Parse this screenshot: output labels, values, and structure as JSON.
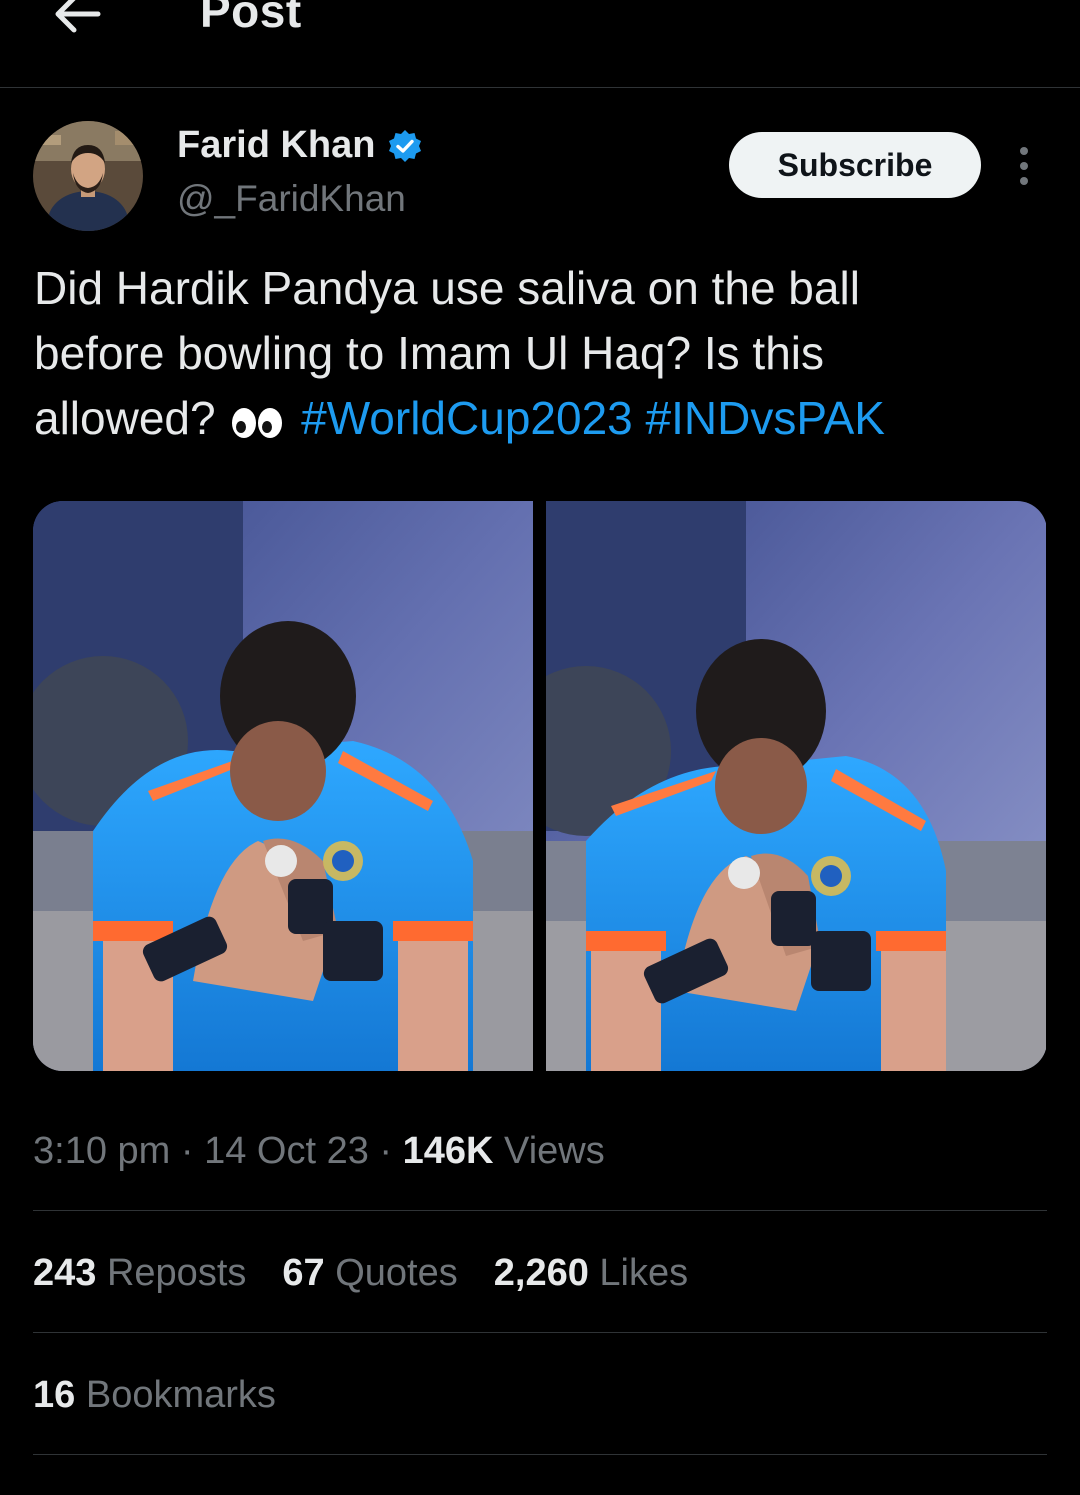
{
  "header": {
    "title": "Post",
    "back_icon": "arrow-left-icon"
  },
  "author": {
    "display_name": "Farid Khan",
    "handle": "@_FaridKhan",
    "verified_icon": "verified-badge-icon",
    "verified_color": "#1d9bf0"
  },
  "actions": {
    "subscribe_label": "Subscribe",
    "more_icon": "more-vertical-icon"
  },
  "tweet": {
    "text_line1": "Did Hardik Pandya use saliva on the ball",
    "text_line2": "before bowling to Imam Ul Haq? Is this",
    "text_line3": "allowed?",
    "emoji": "eyes-emoji",
    "hashtags": [
      "#WorldCup2023",
      "#INDvsPAK"
    ],
    "media_count": 2
  },
  "meta": {
    "time": "3:10 pm",
    "sep1": "·",
    "date": "14 Oct 23",
    "sep2": "·",
    "views_count": "146K",
    "views_label": "Views"
  },
  "stats": {
    "reposts_count": "243",
    "reposts_label": "Reposts",
    "quotes_count": "67",
    "quotes_label": "Quotes",
    "likes_count": "2,260",
    "likes_label": "Likes",
    "bookmarks_count": "16",
    "bookmarks_label": "Bookmarks"
  },
  "colors": {
    "background": "#000000",
    "text": "#e7e9ea",
    "secondary_text": "#71767b",
    "link": "#1d9bf0",
    "divider": "#2f3336"
  }
}
